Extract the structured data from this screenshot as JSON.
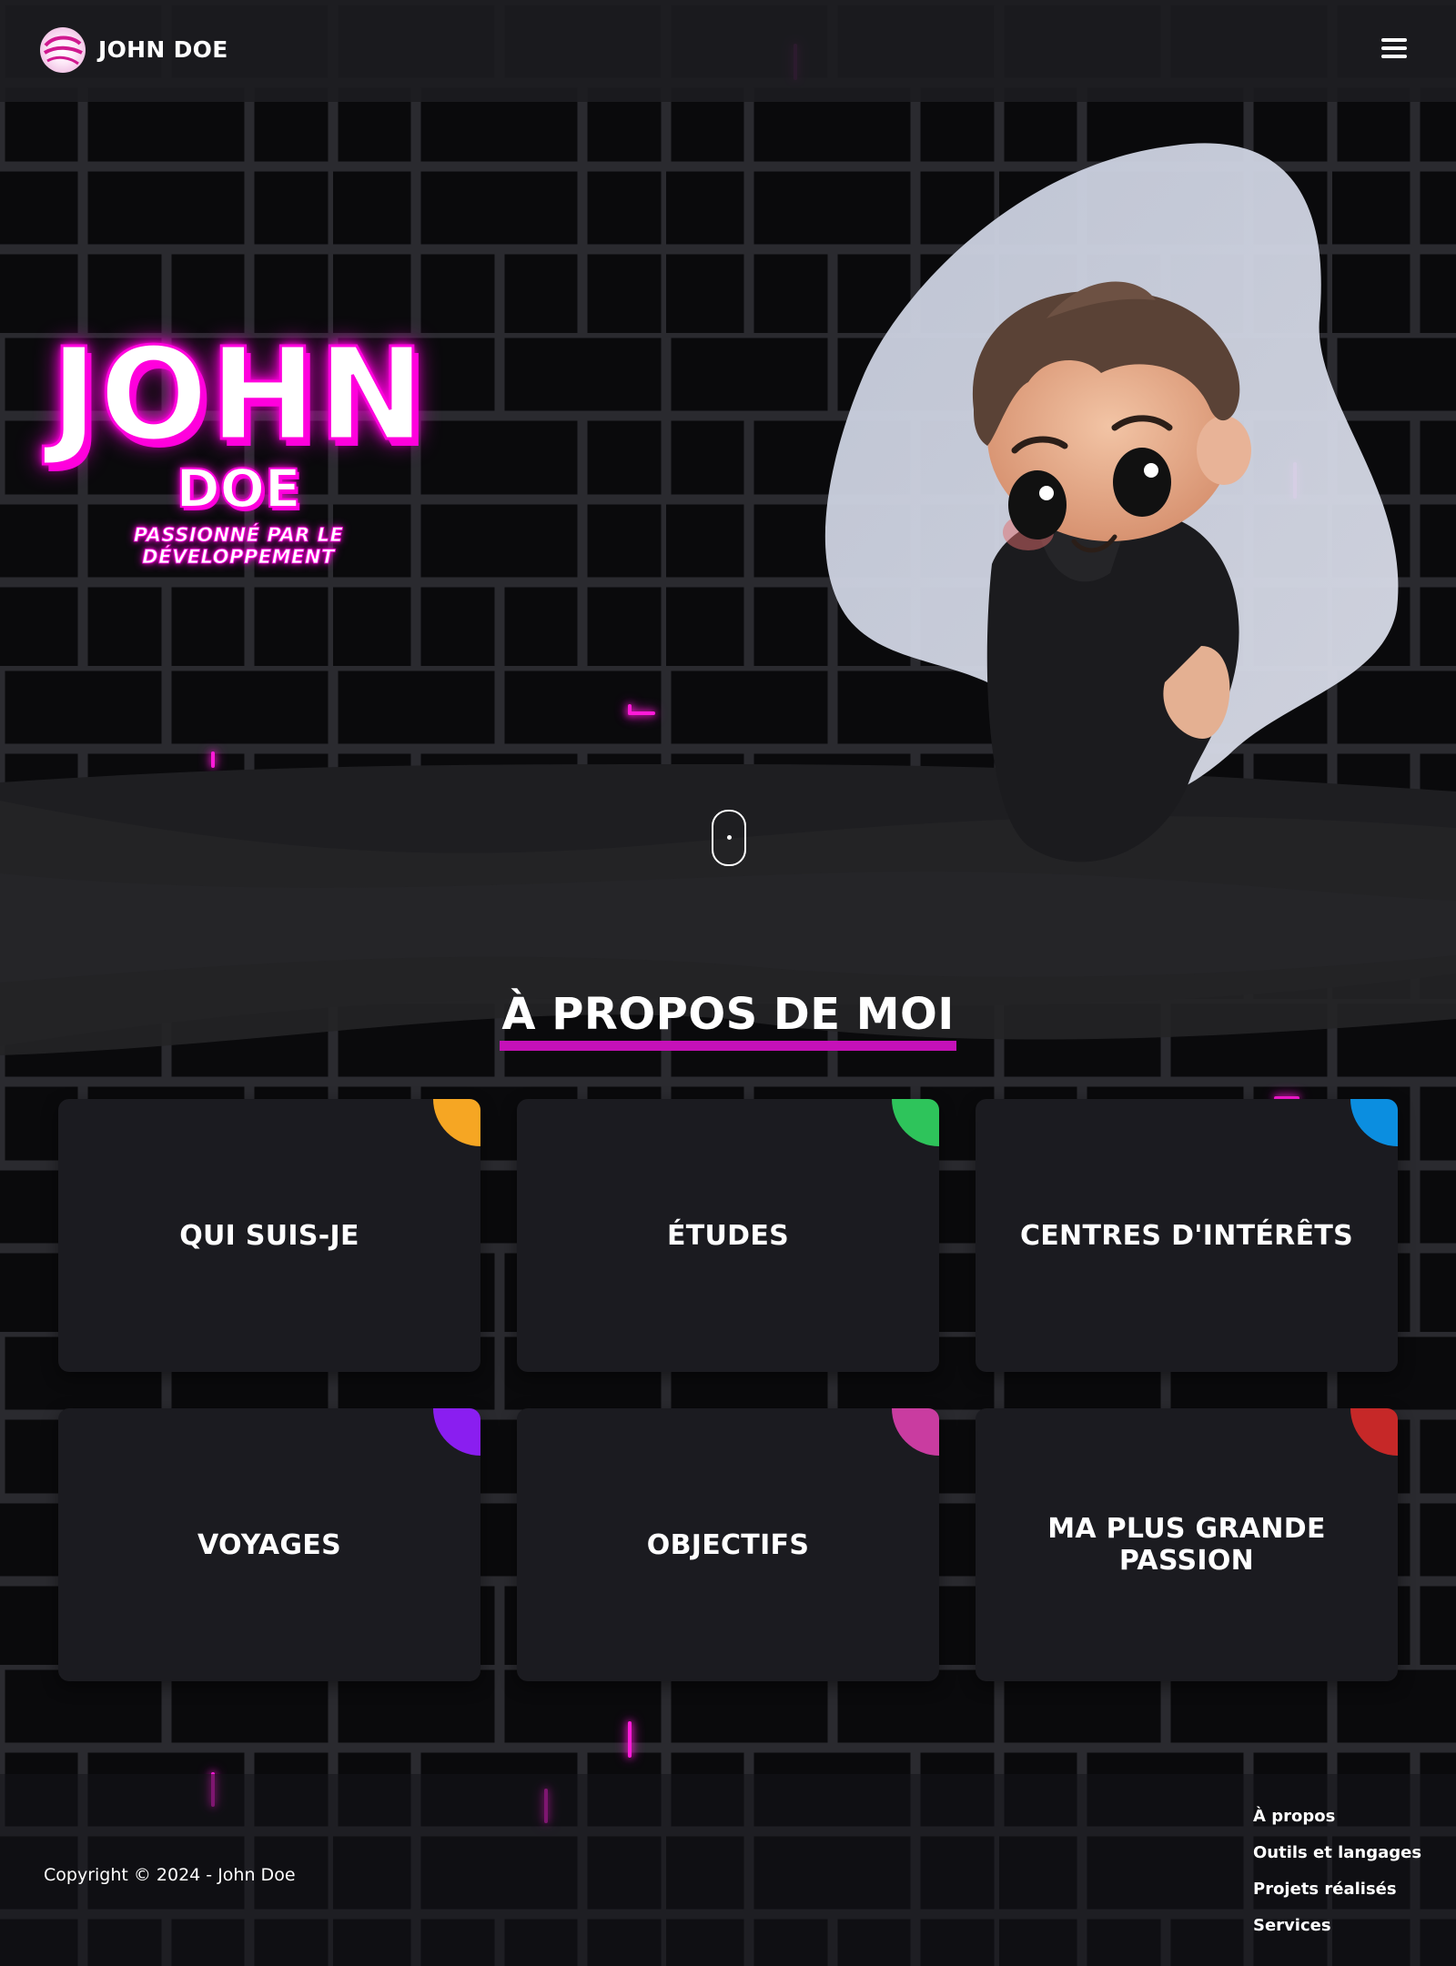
{
  "header": {
    "brand": "JOHN DOE",
    "logo_icon": "swirl-logo-icon",
    "menu_icon": "hamburger-menu-icon"
  },
  "hero": {
    "name": "JOHN",
    "surname": "DOE",
    "tagline": "PASSIONNÉ PAR LE DÉVELOPPEMENT",
    "avatar": "3d-cartoon-avatar-illustration",
    "scroll_icon": "mouse-scroll-icon"
  },
  "about": {
    "title": "À PROPOS DE MOI",
    "cards": [
      {
        "label": "QUI SUIS-JE",
        "accent": "#f6a623"
      },
      {
        "label": "ÉTUDES",
        "accent": "#2ec45b"
      },
      {
        "label": "CENTRES D'INTÉRÊTS",
        "accent": "#0b8ee0"
      },
      {
        "label": "VOYAGES",
        "accent": "#8a1ef0"
      },
      {
        "label": "OBJECTIFS",
        "accent": "#c93ca0"
      },
      {
        "label": "MA PLUS GRANDE PASSION",
        "accent": "#c62828"
      }
    ]
  },
  "footer": {
    "copyright": "Copyright © 2024 - John Doe",
    "links": [
      "À propos",
      "Outils et langages",
      "Projets réalisés",
      "Services"
    ]
  },
  "colors": {
    "neon": "#ff00dd",
    "background": "#0b0b0d",
    "card": "#1b1b20",
    "underline": "#c511b8"
  }
}
